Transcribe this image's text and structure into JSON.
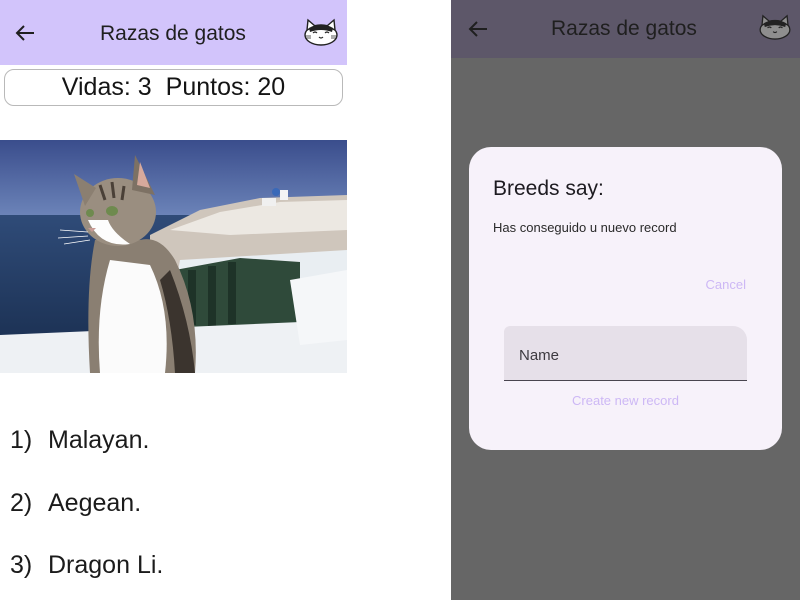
{
  "app": {
    "title": "Razas de gatos",
    "icons": {
      "back": "arrow-left-icon",
      "logo": "cat-face-logo"
    },
    "colors": {
      "appbar": "#d2c4fb",
      "appbar_dimmed": "#5d5769",
      "scrim": "#666666",
      "dialog_bg": "#f7f2fa",
      "accent_text": "#cdb8f5"
    }
  },
  "score": {
    "lives_label": "Vidas: 3",
    "points_label": "Puntos: 20"
  },
  "options": [
    {
      "number": "1)",
      "label": "Malayan."
    },
    {
      "number": "2)",
      "label": "Aegean."
    },
    {
      "number": "3)",
      "label": "Dragon Li."
    }
  ],
  "dialog": {
    "title": "Breeds say:",
    "message": "Has conseguido u nuevo record",
    "cancel_label": "Cancel",
    "name_placeholder": "Name",
    "create_label": "Create new record"
  }
}
